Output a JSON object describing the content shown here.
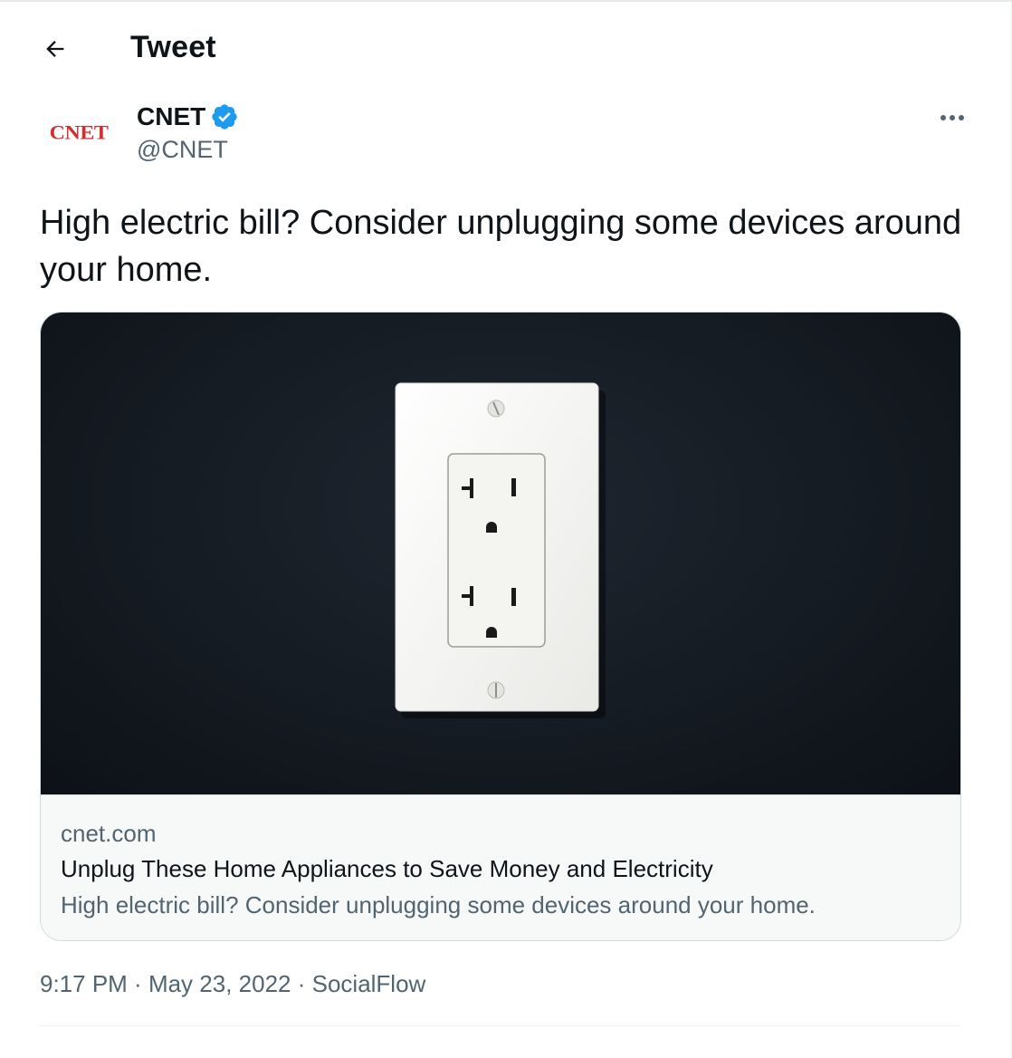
{
  "header": {
    "title": "Tweet",
    "back_icon": "arrow-left-icon"
  },
  "author": {
    "avatar_text": "CNET",
    "name": "CNET",
    "handle": "@CNET",
    "verified_color": "#1d9bf0",
    "more_icon": "more-horizontal-icon"
  },
  "tweet": {
    "text": "High electric bill? Consider unplugging some devices around your home."
  },
  "card": {
    "image_alt": "white wall outlet on a dark wall",
    "domain": "cnet.com",
    "title": "Unplug These Home Appliances to Save Money and Electricity",
    "description": "High electric bill? Consider unplugging some devices around your home."
  },
  "meta": {
    "time": "9:17 PM",
    "separator": " · ",
    "date": "May 23, 2022",
    "source": "SocialFlow"
  },
  "colors": {
    "brand_red": "#d32f2f",
    "text_primary": "#0f1419",
    "text_secondary": "#536471",
    "border": "#cfd9de"
  }
}
